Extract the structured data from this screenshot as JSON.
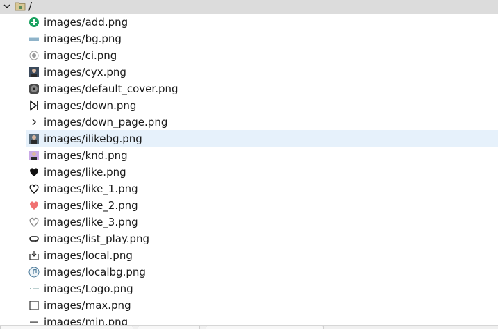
{
  "tree": {
    "root": {
      "label": "/",
      "icon": "folder-icon",
      "expanded": true
    },
    "items": [
      {
        "label": "images/add.png",
        "icon": "add-icon",
        "color": "#1aa260"
      },
      {
        "label": "images/bg.png",
        "icon": "background-image-icon",
        "color": "#8fb3c9"
      },
      {
        "label": "images/ci.png",
        "icon": "ci-icon",
        "color": "#9a9a9a"
      },
      {
        "label": "images/cyx.png",
        "icon": "photo-thumbnail-icon",
        "color": "#3b4a5c"
      },
      {
        "label": "images/default_cover.png",
        "icon": "disc-icon",
        "color": "#4a4a4a"
      },
      {
        "label": "images/down.png",
        "icon": "skip-next-icon",
        "color": "#1a1a1a"
      },
      {
        "label": "images/down_page.png",
        "icon": "chevron-right-icon",
        "color": "#1a1a1a"
      },
      {
        "label": "images/ilikebg.png",
        "icon": "photo-thumbnail-icon",
        "color": "#5a6e7d",
        "selected": true
      },
      {
        "label": "images/knd.png",
        "icon": "photo-thumbnail-icon",
        "color": "#c9a9e6"
      },
      {
        "label": "images/like.png",
        "icon": "heart-filled-icon",
        "color": "#111111"
      },
      {
        "label": "images/like_1.png",
        "icon": "heart-outline-icon",
        "color": "#111111"
      },
      {
        "label": "images/like_2.png",
        "icon": "heart-filled-icon",
        "color": "#f07070"
      },
      {
        "label": "images/like_3.png",
        "icon": "heart-outline-icon",
        "color": "#8a8a8a"
      },
      {
        "label": "images/list_play.png",
        "icon": "loop-icon",
        "color": "#1a1a1a"
      },
      {
        "label": "images/local.png",
        "icon": "download-icon",
        "color": "#333333"
      },
      {
        "label": "images/localbg.png",
        "icon": "music-disc-icon",
        "color": "#4a7a9a"
      },
      {
        "label": "images/Logo.png",
        "icon": "logo-icon",
        "color": "#7aa0a0"
      },
      {
        "label": "images/max.png",
        "icon": "maximize-icon",
        "color": "#333333"
      },
      {
        "label": "images/min.png",
        "icon": "minimize-icon",
        "color": "#333333"
      }
    ]
  }
}
